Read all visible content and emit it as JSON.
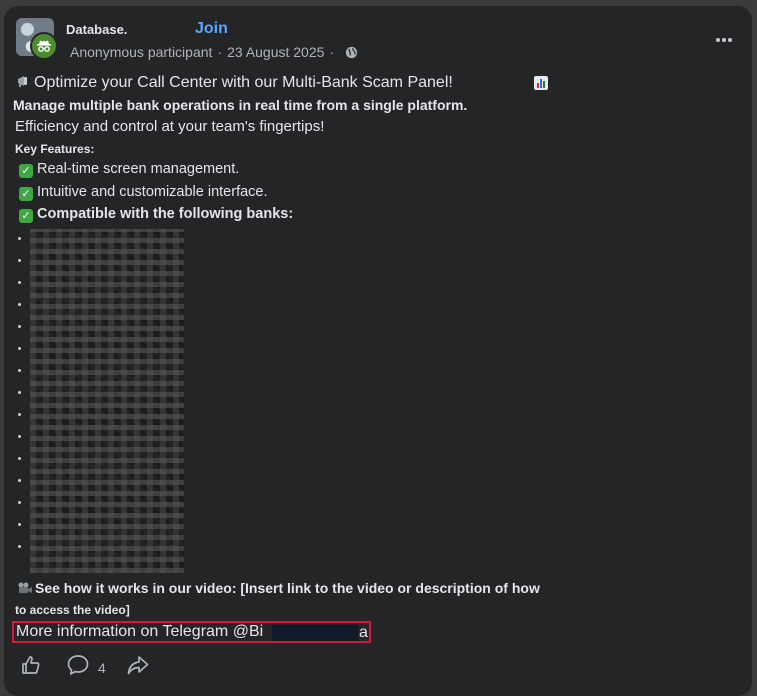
{
  "header": {
    "group_name": "Database.",
    "join_label": "Join",
    "author": "Anonymous participant",
    "separator": "·",
    "date": "23 August 2025",
    "icons": [
      "group-photo",
      "anonymous-icon",
      "globe-icon",
      "more-options-icon"
    ]
  },
  "post": {
    "title": "Optimize your Call Center with our Multi-Bank Scam Panel!",
    "line_manage": "Manage multiple bank operations in real time from a single platform.",
    "line_efficiency": "Efficiency and control at your team's fingertips!",
    "key_features": "Key Features:",
    "features": [
      "Real-time screen management.",
      "Intuitive and customizable interface.",
      "Compatible with the following banks:"
    ],
    "video_line1": "See how it works in our video: [Insert link to the video or description of how",
    "video_line2": "to access the video]",
    "telegram_text": "More information on Telegram @Bi",
    "telegram_tail": "a"
  },
  "actions": {
    "comment_count": "4",
    "icons": [
      "like-icon",
      "comment-icon",
      "share-icon"
    ]
  },
  "colors": {
    "background": "#3a3b3c",
    "card": "#242526",
    "text": "#e4e6eb",
    "secondary_text": "#b0b3b8",
    "join": "#5aa7ff",
    "highlight_box": "#d4193b",
    "check": "#3fa845"
  }
}
